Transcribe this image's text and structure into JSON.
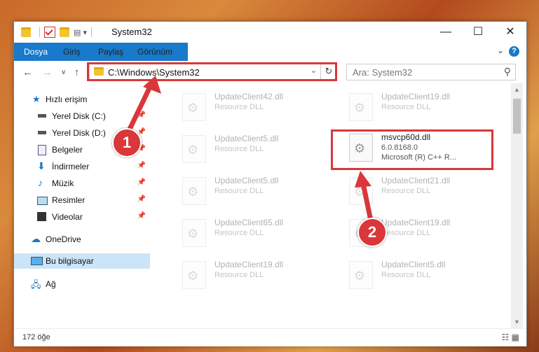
{
  "window": {
    "title": "System32",
    "controls": {
      "minimize": "—",
      "maximize": "☐",
      "close": "✕"
    }
  },
  "ribbon": {
    "tabs": [
      "Dosya",
      "Giriş",
      "Paylaş",
      "Görünüm"
    ],
    "help": "?"
  },
  "address": {
    "path": "C:\\Windows\\System32",
    "search_placeholder": "Ara: System32"
  },
  "nav": {
    "items": [
      {
        "label": "Hızlı erişim",
        "icon": "star-icon"
      },
      {
        "label": "Yerel Disk (C:)",
        "icon": "drive-icon"
      },
      {
        "label": "Yerel Disk (D:)",
        "icon": "drive-icon"
      },
      {
        "label": "Belgeler",
        "icon": "documents-icon"
      },
      {
        "label": "İndirmeler",
        "icon": "download-icon"
      },
      {
        "label": "Müzik",
        "icon": "music-icon"
      },
      {
        "label": "Resimler",
        "icon": "pictures-icon"
      },
      {
        "label": "Videolar",
        "icon": "videos-icon"
      },
      {
        "label": "OneDrive",
        "icon": "cloud-icon"
      },
      {
        "label": "Bu bilgisayar",
        "icon": "computer-icon"
      },
      {
        "label": "Ağ",
        "icon": "network-icon"
      }
    ]
  },
  "files": [
    {
      "name": "UpdateClient42.dll",
      "desc": "Resource DLL"
    },
    {
      "name": "UpdateClient19.dll",
      "desc": "Resource DLL"
    },
    {
      "name": "UpdateClient5.dll",
      "desc": "Resource DLL"
    },
    {
      "name": "msvcp60d.dll",
      "version": "6.0.8168.0",
      "desc": "Microsoft (R) C++ R..."
    },
    {
      "name": "UpdateClient5.dll",
      "desc": "Resource DLL"
    },
    {
      "name": "UpdateClient21.dll",
      "desc": "Resource DLL"
    },
    {
      "name": "UpdateClient65.dll",
      "desc": "Resource DLL"
    },
    {
      "name": "UpdateClient19.dll",
      "desc": "Resource DLL"
    },
    {
      "name": "UpdateClient19.dll",
      "desc": "Resource DLL"
    },
    {
      "name": "UpdateClient5.dll",
      "desc": "Resource DLL"
    }
  ],
  "status": {
    "count": "172 öğe"
  },
  "callouts": [
    "1",
    "2"
  ]
}
